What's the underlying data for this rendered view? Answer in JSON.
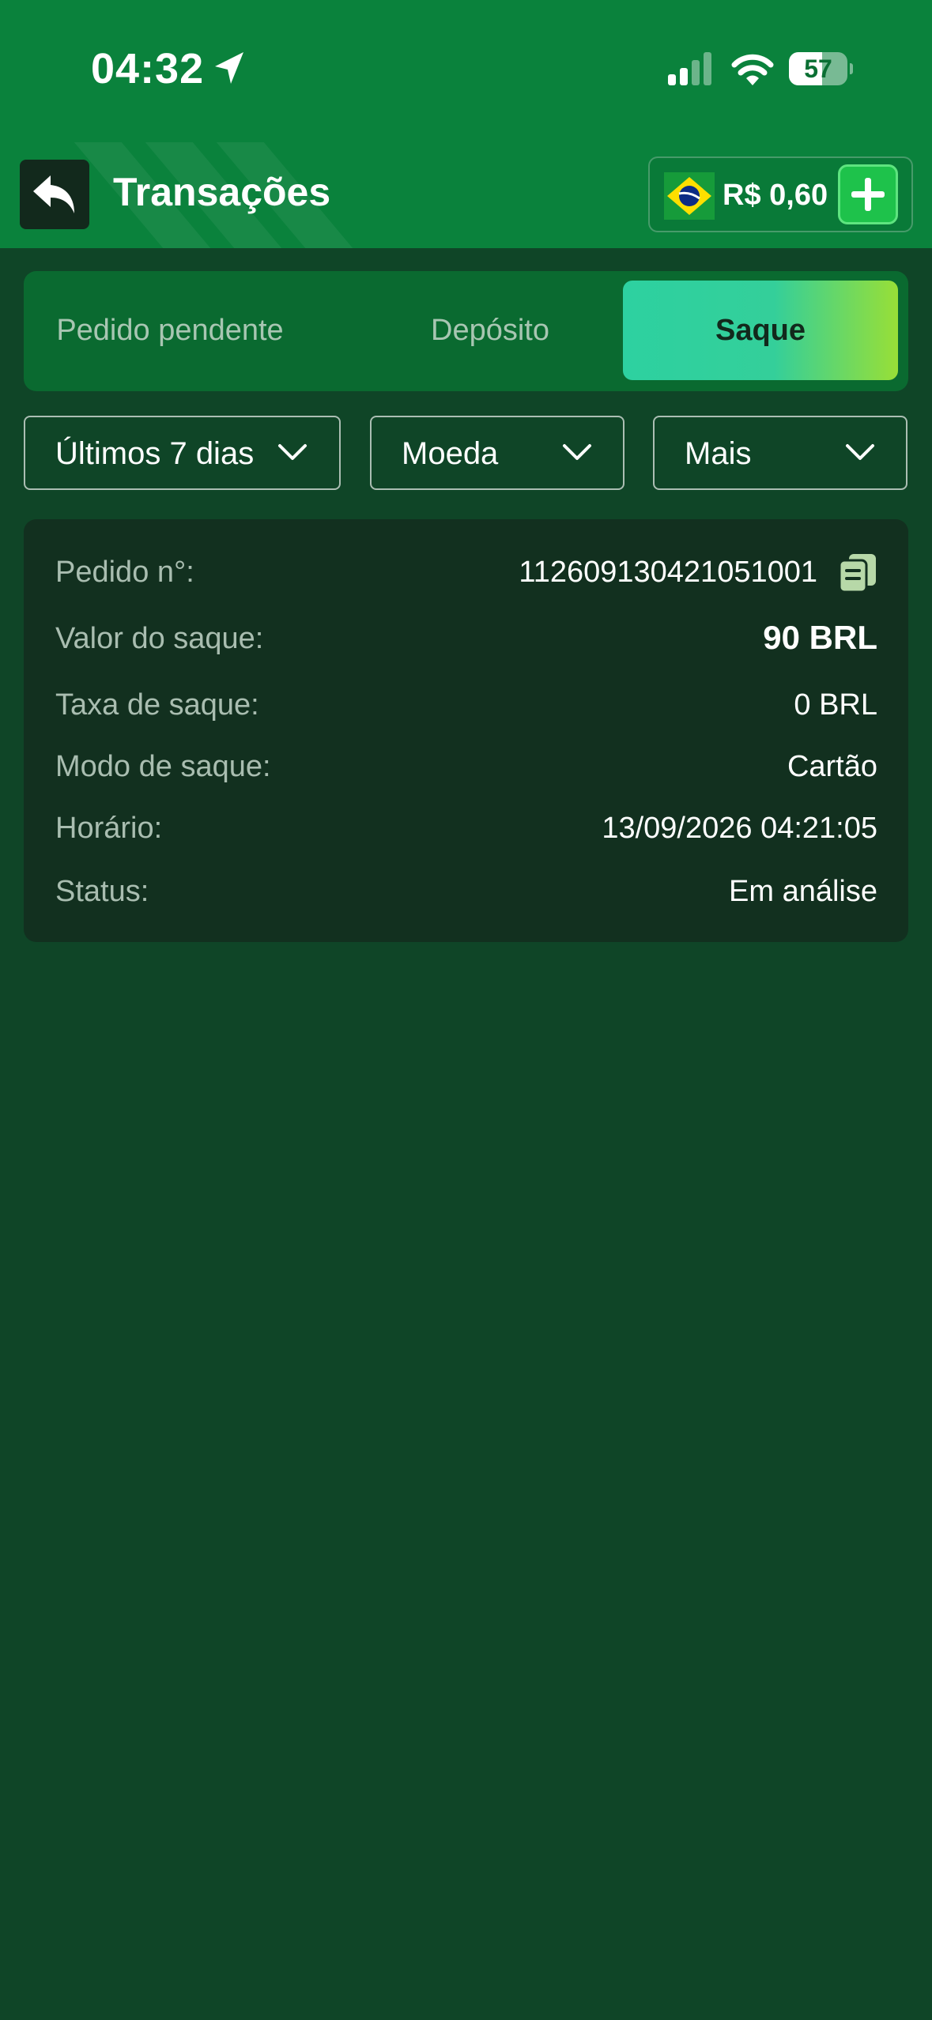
{
  "status_bar": {
    "time": "04:32",
    "battery_level": "57",
    "battery_fraction": 0.57,
    "icons": [
      "location-arrow-icon",
      "signal-icon",
      "wifi-icon",
      "battery-icon"
    ]
  },
  "header": {
    "back_icon": "reply-arrow-icon",
    "title": "Transações",
    "balance": {
      "flag_icon": "brazil-flag-icon",
      "value": "R$ 0,60",
      "add_icon": "plus-icon"
    }
  },
  "tabs": [
    {
      "label": "Pedido pendente",
      "active": false
    },
    {
      "label": "Depósito",
      "active": false
    },
    {
      "label": "Saque",
      "active": true
    }
  ],
  "filters": [
    {
      "label": "Últimos 7 dias"
    },
    {
      "label": "Moeda"
    },
    {
      "label": "Mais"
    }
  ],
  "transaction": {
    "order": {
      "label": "Pedido n°:",
      "value": "112609130421051001"
    },
    "amount": {
      "label": "Valor do saque:",
      "value": "90 BRL"
    },
    "fee": {
      "label": "Taxa de saque:",
      "value": "0 BRL"
    },
    "mode": {
      "label": "Modo de saque:",
      "value": "Cartão"
    },
    "time": {
      "label": "Horário:",
      "value": "13/09/2026 04:21:05"
    },
    "status": {
      "label": "Status:",
      "value": "Em análise"
    }
  },
  "colors": {
    "header_green": "#0a823c",
    "background": "#0f4527",
    "card": "#12301f",
    "active_tab_start": "#2dd1a0",
    "active_tab_end": "#98df37",
    "add_button": "#1ec24b"
  }
}
